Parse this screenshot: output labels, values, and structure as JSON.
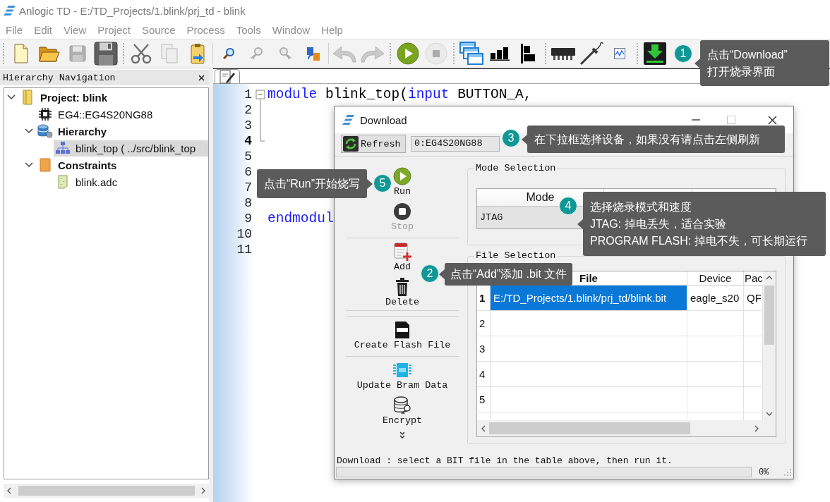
{
  "window": {
    "title": "Anlogic TD - E:/TD_Projects/1.blink/prj_td - blink"
  },
  "menu": [
    "File",
    "Edit",
    "View",
    "Project",
    "Source",
    "Process",
    "Tools",
    "Window",
    "Help"
  ],
  "toolbar": [
    [
      {
        "kind": "new",
        "disabled": false
      },
      {
        "kind": "open",
        "disabled": false
      },
      {
        "kind": "save",
        "disabled": true
      },
      {
        "kind": "saveall",
        "disabled": false
      }
    ],
    [
      {
        "kind": "cut",
        "disabled": false
      },
      {
        "kind": "copy",
        "disabled": true
      },
      {
        "kind": "paste",
        "disabled": false
      }
    ],
    [
      {
        "kind": "find",
        "disabled": false
      },
      {
        "kind": "findprev",
        "disabled": true
      },
      {
        "kind": "findnext",
        "disabled": true
      },
      {
        "kind": "replace",
        "disabled": false
      }
    ],
    [
      {
        "kind": "undo",
        "disabled": true
      },
      {
        "kind": "redo",
        "disabled": true
      }
    ],
    [
      {
        "kind": "run",
        "disabled": false
      },
      {
        "kind": "stop",
        "disabled": true
      }
    ],
    [
      {
        "kind": "windows",
        "disabled": false
      },
      {
        "kind": "chart",
        "disabled": false
      },
      {
        "kind": "align",
        "disabled": false
      }
    ],
    [
      {
        "kind": "chip",
        "disabled": false
      },
      {
        "kind": "probe",
        "disabled": false
      },
      {
        "kind": "wave",
        "disabled": false
      }
    ],
    [
      {
        "kind": "download",
        "disabled": false
      }
    ]
  ],
  "hierarchy_panel": {
    "title": "Hierarchy Navigation",
    "tree": [
      {
        "label": "Project: blink",
        "kind": "project",
        "expanded": true,
        "selected": false,
        "children": [
          {
            "label": "EG4::EG4S20NG88",
            "kind": "device",
            "selected": false
          },
          {
            "label": "Hierarchy",
            "kind": "hierarchy",
            "expanded": true,
            "selected": false,
            "children": [
              {
                "label": "blink_top ( ../src/blink_top",
                "kind": "module",
                "selected": true
              }
            ]
          },
          {
            "label": "Constraints",
            "kind": "constraints",
            "expanded": true,
            "selected": false,
            "children": [
              {
                "label": "blink.adc",
                "kind": "file",
                "selected": false
              }
            ]
          }
        ]
      }
    ]
  },
  "editor": {
    "lines": [
      {
        "number": "1",
        "current": false,
        "tokens": [
          {
            "text": "module",
            "kind": "keyword"
          },
          {
            "text": " blink_top(",
            "kind": "plain"
          },
          {
            "text": "input",
            "kind": "keyword"
          },
          {
            "text": " BUTTON_A,",
            "kind": "plain"
          }
        ]
      },
      {
        "number": "2",
        "current": false
      },
      {
        "number": "3",
        "current": false
      },
      {
        "number": "4",
        "current": true
      },
      {
        "number": "5",
        "current": false
      },
      {
        "number": "6",
        "current": false
      },
      {
        "number": "7",
        "current": false
      },
      {
        "number": "8",
        "current": false
      },
      {
        "number": "9",
        "current": false,
        "tokens": [
          {
            "text": "endmodul",
            "kind": "keyword"
          }
        ]
      },
      {
        "number": "10",
        "current": false
      },
      {
        "number": "11",
        "current": false
      }
    ]
  },
  "download_dialog": {
    "title": "Download",
    "refresh_button": "Refresh",
    "device": "0:EG4S20NG88",
    "actions": [
      [
        {
          "label": "Run",
          "kind": "run",
          "disabled": false
        },
        {
          "label": "Stop",
          "kind": "stop",
          "disabled": true
        }
      ],
      [
        {
          "label": "Add",
          "kind": "add",
          "disabled": false
        },
        {
          "label": "Delete",
          "kind": "delete",
          "disabled": false
        }
      ],
      [
        {
          "label": "Create Flash File",
          "kind": "flash",
          "disabled": false
        }
      ],
      [
        {
          "label": "Update Bram Data",
          "kind": "bram",
          "disabled": false
        },
        {
          "label": "Encrypt",
          "kind": "encrypt",
          "disabled": false
        }
      ]
    ],
    "mode_selection": {
      "title": "Mode Selection",
      "columns": [
        "Mode"
      ],
      "rows": [
        [
          "JTAG"
        ]
      ]
    },
    "file_selection": {
      "title": "File Selection",
      "columns": [
        "File",
        "Device",
        "Pac"
      ],
      "rows": [
        {
          "number": "1",
          "selected": true,
          "cells": [
            "E:/TD_Projects/1.blink/prj_td/blink.bit",
            "eagle_s20",
            "QF"
          ]
        },
        {
          "number": "2",
          "selected": false
        },
        {
          "number": "3",
          "selected": false
        },
        {
          "number": "4",
          "selected": false
        },
        {
          "number": "5",
          "selected": false
        }
      ]
    },
    "status": "Download : select a BIT file in the table above, then run it.",
    "progress": {
      "level": 0,
      "reading": "0%"
    }
  },
  "callouts": [
    {
      "number": "1",
      "lines": [
        "点击“Download”",
        "打开烧录界面"
      ]
    },
    {
      "number": "2",
      "lines": [
        "点击“Add”添加 .bit 文件"
      ]
    },
    {
      "number": "3",
      "lines": [
        "在下拉框选择设备，如果没有请点击左侧刷新"
      ]
    },
    {
      "number": "4",
      "lines": [
        "选择烧录模式和速度",
        "JTAG: 掉电丢失，适合实验",
        "PROGRAM FLASH: 掉电不失，可长期运行"
      ]
    },
    {
      "number": "5",
      "lines": [
        "点击“Run”开始烧写"
      ]
    }
  ]
}
